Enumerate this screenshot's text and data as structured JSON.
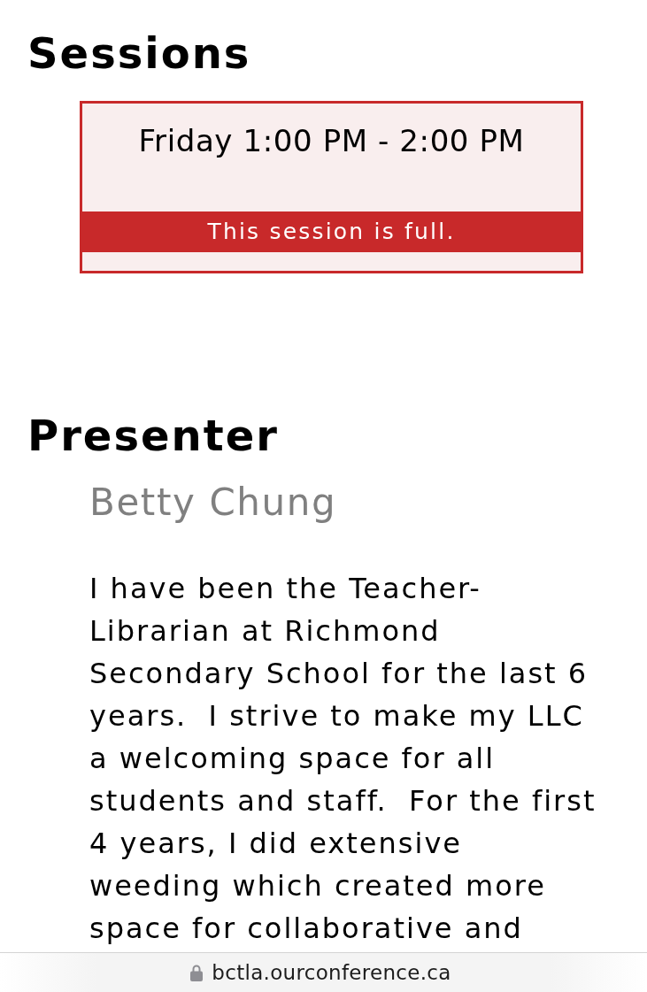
{
  "sessions": {
    "heading": "Sessions",
    "items": [
      {
        "time": "Friday 1:00 PM - 2:00 PM",
        "full": true,
        "status": "This session is full."
      }
    ]
  },
  "presenter": {
    "heading": "Presenter",
    "name": "Betty Chung",
    "bio": "I have been the Teacher-Librarian at Richmond Secondary School for the last 6 years.  I strive to make my LLC a welcoming space for all students and staff.  For the first 4 years, I did extensive weeding which created more space for collaborative and"
  },
  "address_bar": {
    "url": "bctla.ourconference.ca",
    "secure": true
  }
}
